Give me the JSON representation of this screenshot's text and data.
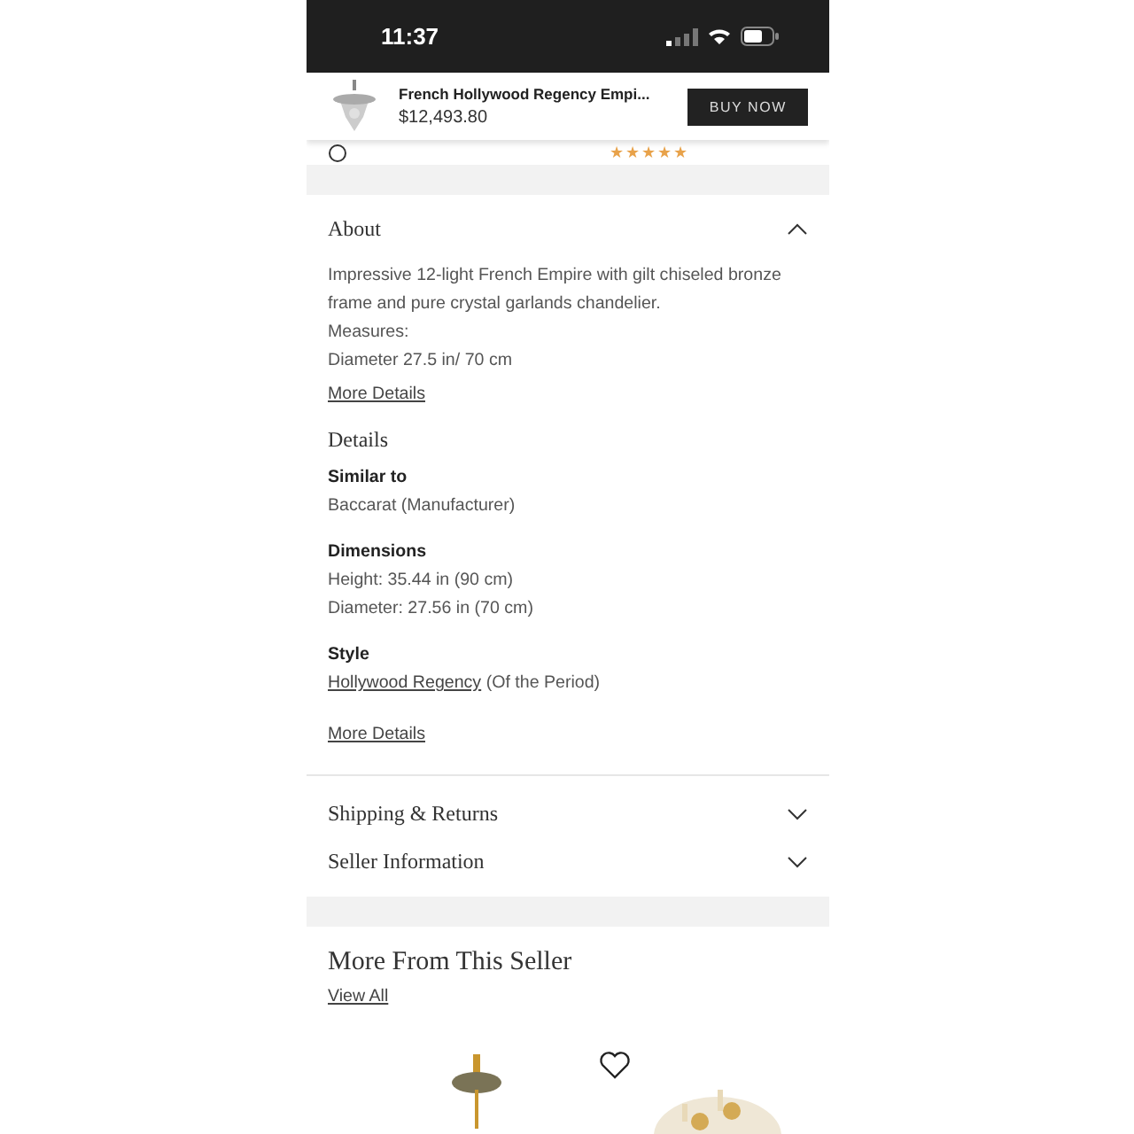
{
  "status_bar": {
    "time": "11:37"
  },
  "sticky_header": {
    "title": "French Hollywood Regency Empi...",
    "price": "$12,493.80",
    "button": "BUY NOW"
  },
  "seller_row": {
    "stars": 5
  },
  "about": {
    "title": "About",
    "expanded": true,
    "description": "Impressive 12-light French Empire with gilt chiseled bronze frame and pure crystal garlands chandelier.",
    "lines": [
      "Measures:",
      "Diameter 27.5 in/ 70 cm"
    ],
    "more_link": "More Details"
  },
  "details": {
    "title": "Details",
    "groups": [
      {
        "label": "Similar to",
        "values": [
          {
            "text": "Baccarat (Manufacturer)"
          }
        ]
      },
      {
        "label": "Dimensions",
        "values": [
          {
            "text": "Height: 35.44 in (90 cm)"
          },
          {
            "text": "Diameter: 27.56 in (70 cm)"
          }
        ]
      },
      {
        "label": "Style",
        "values": [
          {
            "link": "Hollywood Regency",
            "text": " (Of the Period)"
          }
        ]
      }
    ],
    "more_link": "More Details"
  },
  "accordions": [
    {
      "title": "Shipping & Returns",
      "expanded": false
    },
    {
      "title": "Seller Information",
      "expanded": false
    }
  ],
  "more_from_seller": {
    "title": "More From This Seller",
    "link": "View All"
  }
}
